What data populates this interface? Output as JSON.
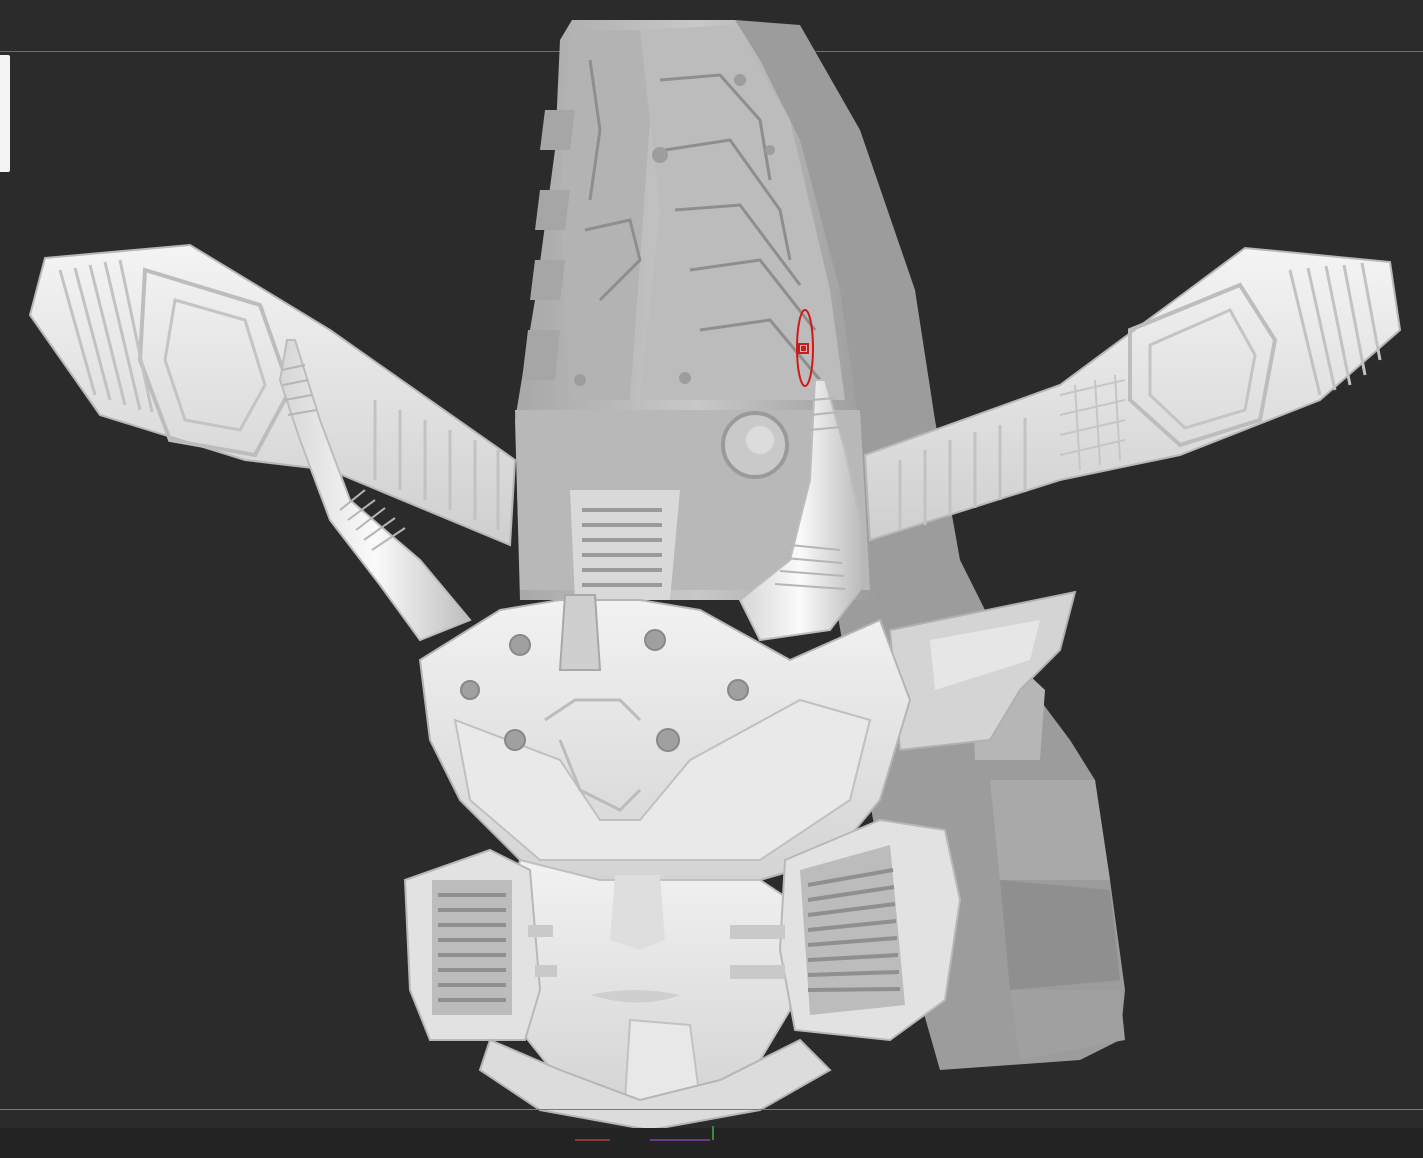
{
  "viewport": {
    "background_color": "#2b2b2b",
    "model_color": "#e6e6e6",
    "gizmo_color": "#d01a1a"
  },
  "icons": {
    "transpose_gizmo": "transpose-gizmo-icon",
    "axis_indicator": "axis-indicator-icon"
  }
}
